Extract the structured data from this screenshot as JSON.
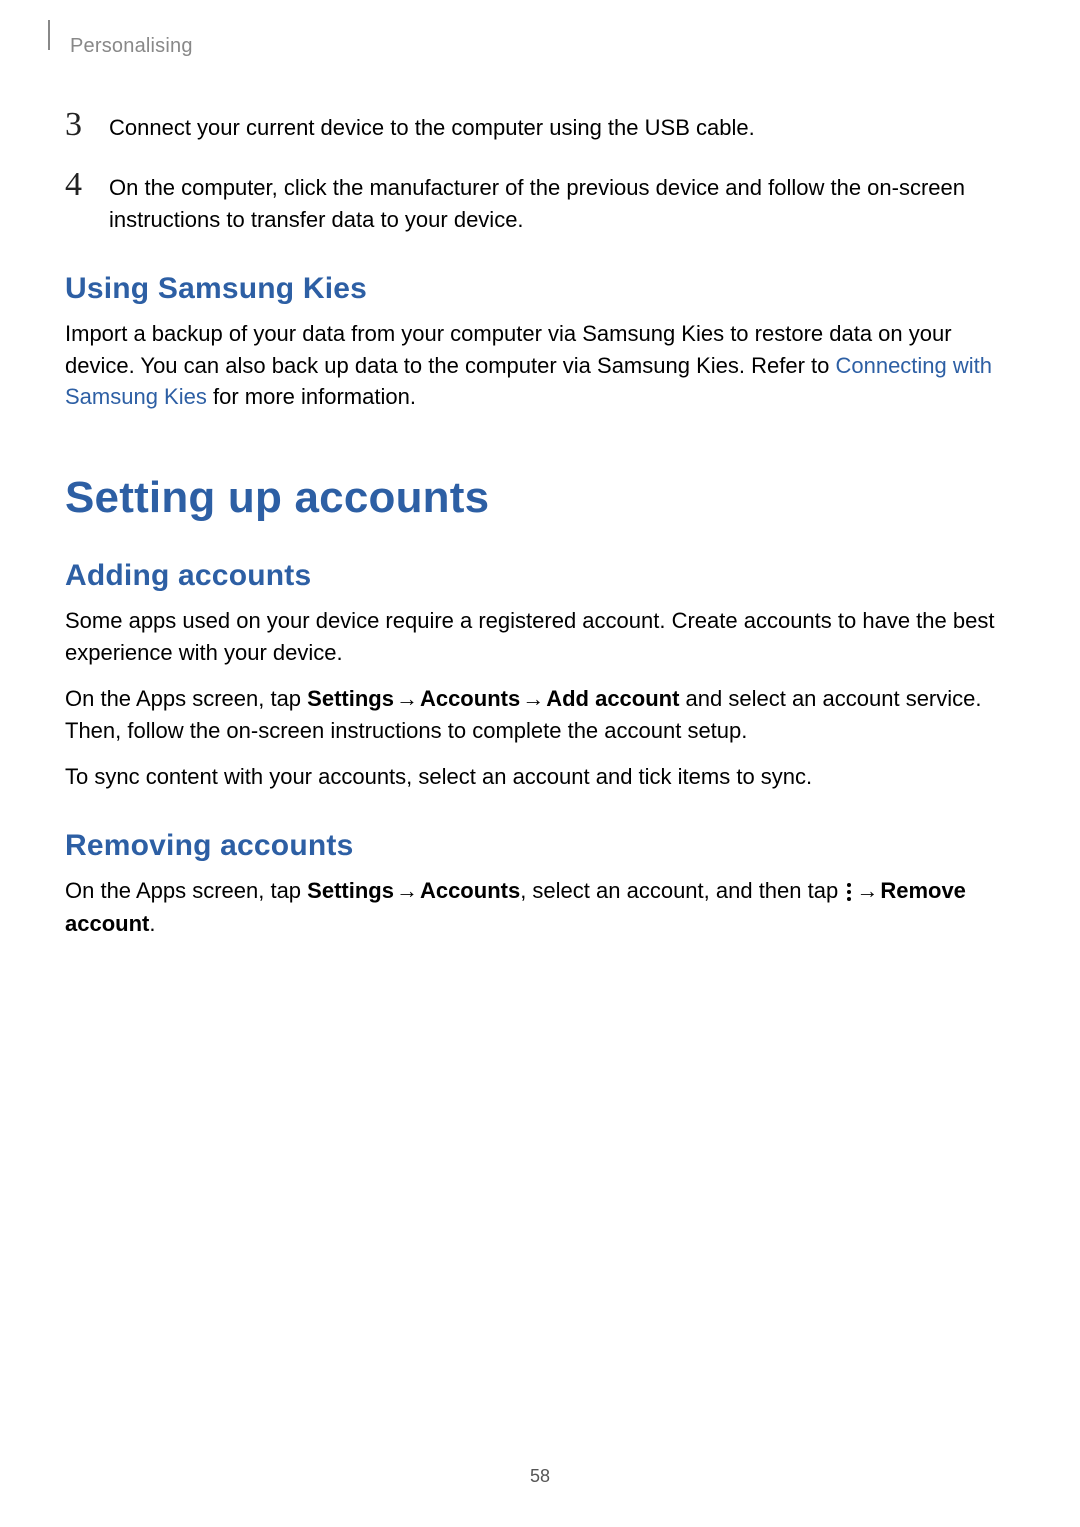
{
  "header": {
    "section_label": "Personalising"
  },
  "steps": {
    "s3_num": "3",
    "s3_text": "Connect your current device to the computer using the USB cable.",
    "s4_num": "4",
    "s4_text": "On the computer, click the manufacturer of the previous device and follow the on-screen instructions to transfer data to your device."
  },
  "kies": {
    "heading": "Using Samsung Kies",
    "p1_a": "Import a backup of your data from your computer via Samsung Kies to restore data on your device. You can also back up data to the computer via Samsung Kies. Refer to ",
    "p1_link": "Connecting with Samsung Kies",
    "p1_b": " for more information."
  },
  "accounts": {
    "heading": "Setting up accounts",
    "adding_heading": "Adding accounts",
    "adding_p1": "Some apps used on your device require a registered account. Create accounts to have the best experience with your device.",
    "adding_p2_a": "On the Apps screen, tap ",
    "adding_p2_b1": "Settings",
    "adding_p2_arrow": " → ",
    "adding_p2_b2": "Accounts",
    "adding_p2_b3": "Add account",
    "adding_p2_c": " and select an account service. Then, follow the on-screen instructions to complete the account setup.",
    "adding_p3": "To sync content with your accounts, select an account and tick items to sync.",
    "removing_heading": "Removing accounts",
    "removing_p1_a": "On the Apps screen, tap ",
    "removing_p1_b1": "Settings",
    "removing_p1_b2": "Accounts",
    "removing_p1_c": ", select an account, and then tap ",
    "removing_p1_b3": "Remove account",
    "removing_p1_d": "."
  },
  "footer": {
    "page_number": "58"
  }
}
